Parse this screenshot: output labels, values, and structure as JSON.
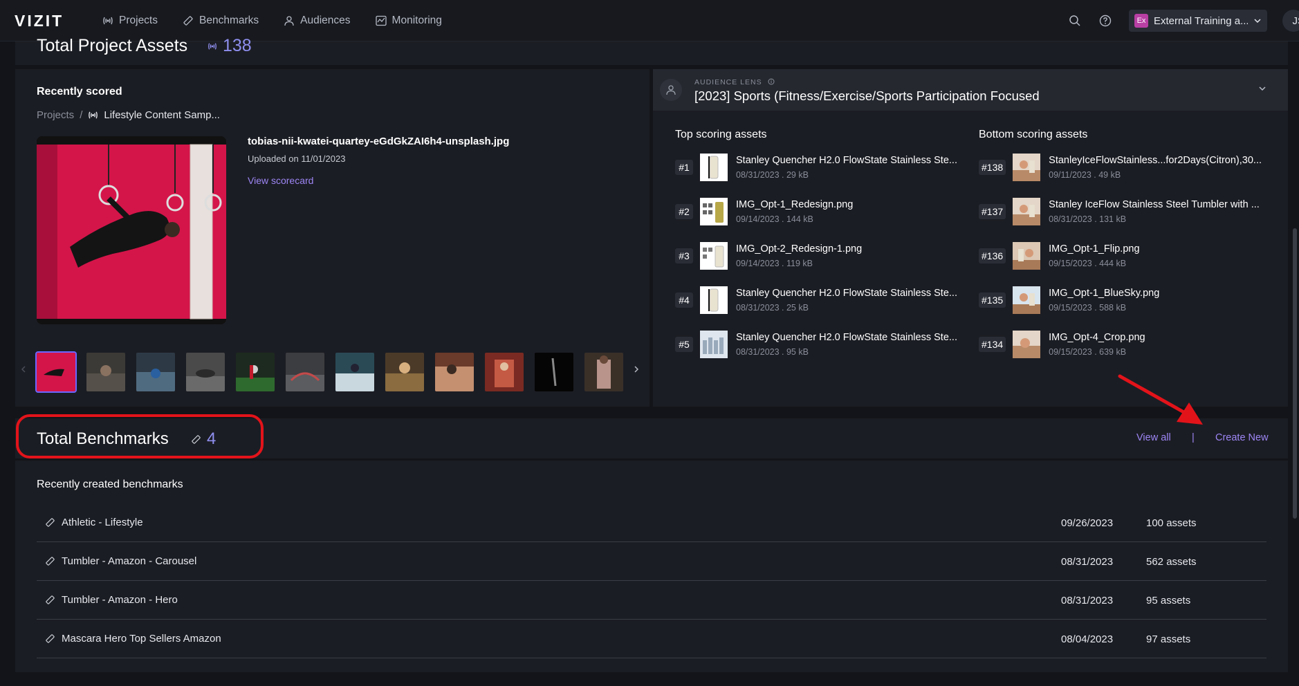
{
  "nav": {
    "logo": "VIZIT",
    "links": [
      {
        "label": "Projects",
        "icon": "projects-icon"
      },
      {
        "label": "Benchmarks",
        "icon": "ruler-icon"
      },
      {
        "label": "Audiences",
        "icon": "person-icon"
      },
      {
        "label": "Monitoring",
        "icon": "chart-icon"
      }
    ],
    "org_badge": "Ex",
    "org_name": "External Training a...",
    "avatar": "JS"
  },
  "assets": {
    "title": "Total Project Assets",
    "count": "138"
  },
  "recent": {
    "title": "Recently scored",
    "breadcrumb_root": "Projects",
    "breadcrumb_sep": "/",
    "breadcrumb_current": "Lifestyle Content Samp...",
    "filename": "tobias-nii-kwatei-quartey-eGdGkZAI6h4-unsplash.jpg",
    "uploaded": "Uploaded on 11/01/2023",
    "view_scorecard": "View scorecard"
  },
  "lens": {
    "label": "AUDIENCE LENS",
    "name": "[2023] Sports (Fitness/Exercise/Sports Participation Focused"
  },
  "top": {
    "title": "Top scoring assets",
    "items": [
      {
        "rank": "#1",
        "name": "Stanley Quencher H2.0 FlowState Stainless Ste...",
        "meta": "08/31/2023 . 29 kB"
      },
      {
        "rank": "#2",
        "name": "IMG_Opt-1_Redesign.png",
        "meta": "09/14/2023 . 144 kB"
      },
      {
        "rank": "#3",
        "name": "IMG_Opt-2_Redesign-1.png",
        "meta": "09/14/2023 . 119 kB"
      },
      {
        "rank": "#4",
        "name": "Stanley Quencher H2.0 FlowState Stainless Ste...",
        "meta": "08/31/2023 . 25 kB"
      },
      {
        "rank": "#5",
        "name": "Stanley Quencher H2.0 FlowState Stainless Ste...",
        "meta": "08/31/2023 . 95 kB"
      }
    ]
  },
  "bottom": {
    "title": "Bottom scoring assets",
    "items": [
      {
        "rank": "#138",
        "name": "StanleyIceFlowStainless...for2Days(Citron),30...",
        "meta": "09/11/2023 . 49 kB"
      },
      {
        "rank": "#137",
        "name": "Stanley IceFlow Stainless Steel Tumbler with ...",
        "meta": "08/31/2023 . 131 kB"
      },
      {
        "rank": "#136",
        "name": "IMG_Opt-1_Flip.png",
        "meta": "09/15/2023 . 444 kB"
      },
      {
        "rank": "#135",
        "name": "IMG_Opt-1_BlueSky.png",
        "meta": "09/15/2023 . 588 kB"
      },
      {
        "rank": "#134",
        "name": "IMG_Opt-4_Crop.png",
        "meta": "09/15/2023 . 639 kB"
      }
    ]
  },
  "benchmarks": {
    "title": "Total Benchmarks",
    "count": "4",
    "view_all": "View all",
    "separator": "|",
    "create_new": "Create New",
    "recent_title": "Recently created benchmarks",
    "items": [
      {
        "name": "Athletic - Lifestyle",
        "date": "09/26/2023",
        "assets": "100 assets"
      },
      {
        "name": "Tumbler - Amazon - Carousel",
        "date": "08/31/2023",
        "assets": "562 assets"
      },
      {
        "name": "Tumbler - Amazon - Hero",
        "date": "08/31/2023",
        "assets": "95 assets"
      },
      {
        "name": "Mascara Hero Top Sellers Amazon",
        "date": "08/04/2023",
        "assets": "97 assets"
      }
    ]
  },
  "colors": {
    "accent": "#9d86f5",
    "count": "#8f8fef",
    "callout": "#e3131a",
    "background": "#121419",
    "panel": "#1b1d24"
  }
}
